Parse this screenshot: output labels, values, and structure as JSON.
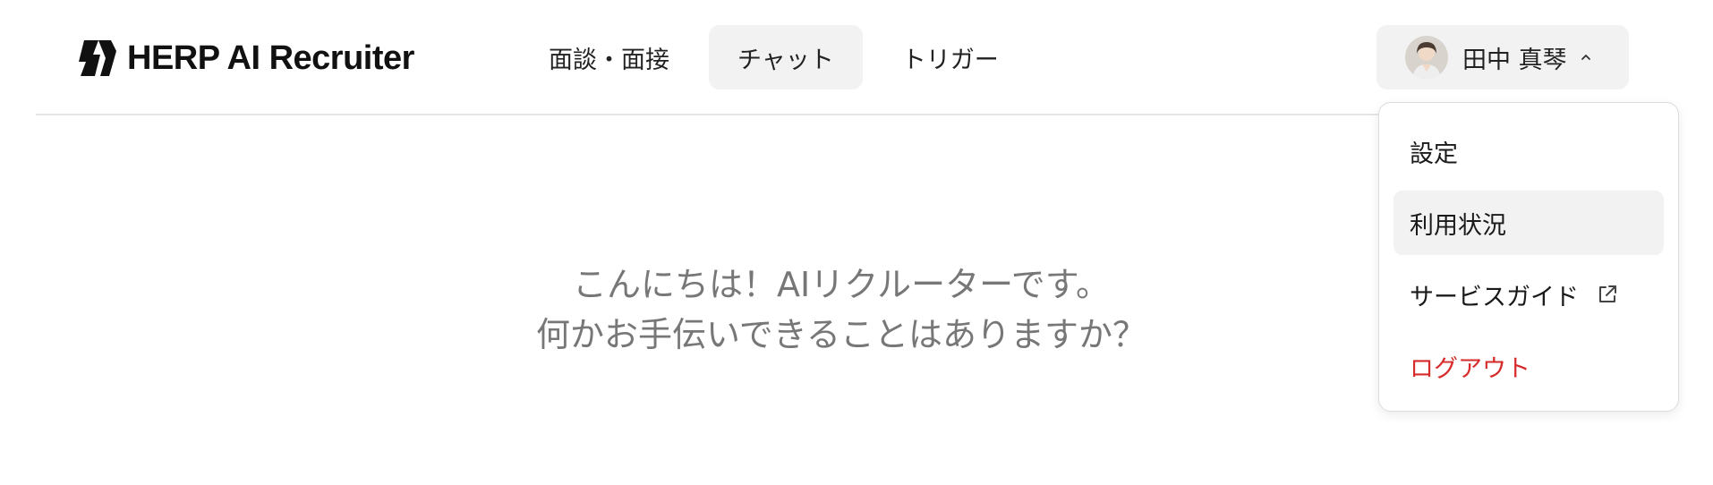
{
  "brand": {
    "name": "HERP AI Recruiter"
  },
  "nav": {
    "items": [
      {
        "label": "面談・面接",
        "active": false
      },
      {
        "label": "チャット",
        "active": true
      },
      {
        "label": "トリガー",
        "active": false
      }
    ]
  },
  "user": {
    "name": "田中 真琴",
    "menu_open": true
  },
  "dropdown": {
    "settings": "設定",
    "usage": "利用状況",
    "service_guide": "サービスガイド",
    "logout": "ログアウト"
  },
  "greeting": {
    "line1": "こんにちは！AIリクルーターです。",
    "line2": "何かお手伝いできることはありますか？"
  },
  "icons": {
    "logo": "herp-logo-icon",
    "chevron": "chevron-up-icon",
    "external": "external-link-icon",
    "avatar": "user-avatar"
  },
  "colors": {
    "accent_bg": "#f2f2f2",
    "danger": "#d62b2b",
    "muted_text": "#777777",
    "divider": "#e5e5e5"
  }
}
